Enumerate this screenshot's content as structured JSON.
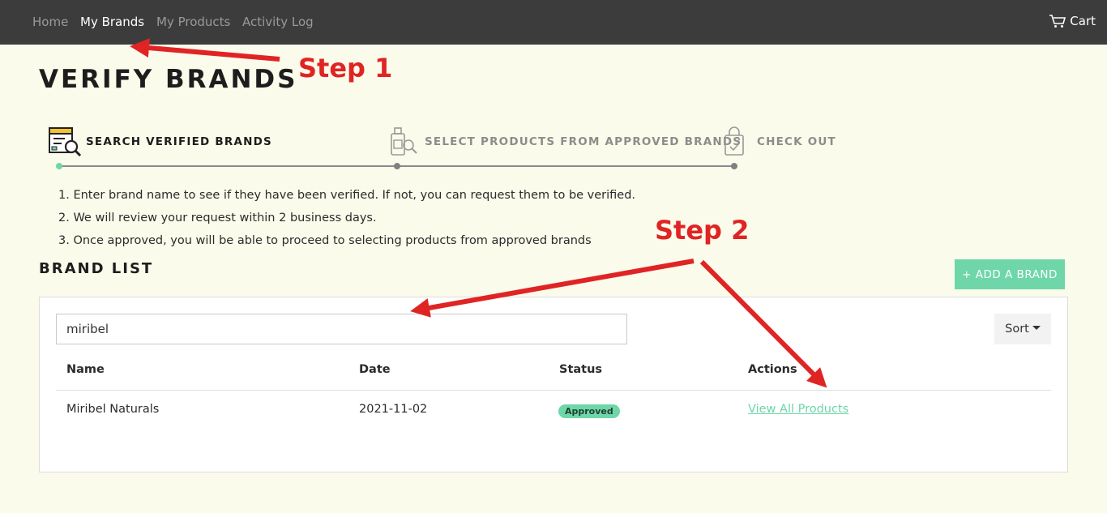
{
  "nav": {
    "items": [
      {
        "label": "Home"
      },
      {
        "label": "My Brands"
      },
      {
        "label": "My Products"
      },
      {
        "label": "Activity Log"
      }
    ],
    "cart_label": "Cart"
  },
  "page": {
    "title": "VERIFY BRANDS"
  },
  "steps": [
    {
      "label": "SEARCH VERIFIED BRANDS",
      "icon": "search-document-icon"
    },
    {
      "label": "SELECT PRODUCTS FROM APPROVED BRANDS",
      "icon": "product-bottle-search-icon"
    },
    {
      "label": "CHECK OUT",
      "icon": "shopping-bag-check-icon"
    }
  ],
  "instructions": [
    "1. Enter brand name to see if they have been verified. If not, you can request them to be verified.",
    "2. We will review your request within 2 business days.",
    "3. Once approved, you will be able to proceed to selecting products from approved brands"
  ],
  "brand_list": {
    "title": "BRAND LIST",
    "add_button": "+ ADD A BRAND",
    "search_value": "miribel",
    "sort_label": "Sort",
    "columns": [
      "Name",
      "Date",
      "Status",
      "Actions"
    ],
    "rows": [
      {
        "name": "Miribel Naturals",
        "date": "2021-11-02",
        "status": "Approved",
        "action": "View All Products"
      }
    ]
  },
  "annotations": {
    "step1": "Step 1",
    "step2": "Step 2"
  },
  "colors": {
    "accent": "#6ed6a8",
    "nav_bg": "#3c3c3c",
    "annotation": "#e02424",
    "page_bg": "#fbfbeb"
  }
}
